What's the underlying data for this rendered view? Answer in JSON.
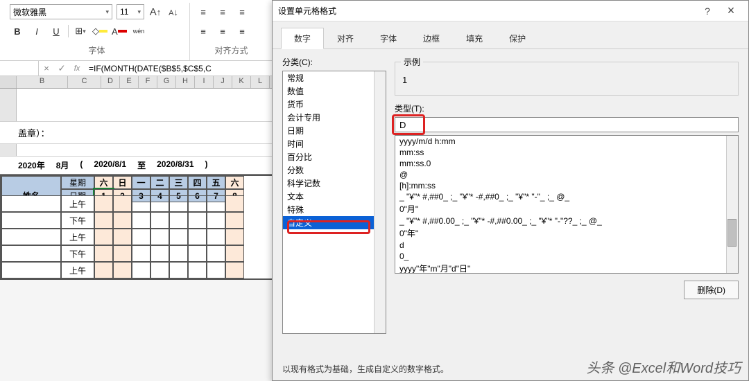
{
  "ribbon": {
    "font_name": "微软雅黑",
    "font_size": "11",
    "grow": "A",
    "shrink": "A",
    "bold": "B",
    "italic": "I",
    "underline": "U",
    "wen": "wén",
    "group_font": "字体",
    "group_align": "对齐方式"
  },
  "formula": {
    "cancel": "×",
    "confirm": "✓",
    "fx": "fx",
    "text": "=IF(MONTH(DATE($B$5,$C$5,C"
  },
  "cols": [
    "B",
    "C",
    "D",
    "E",
    "F",
    "G",
    "H",
    "I",
    "J",
    "K",
    "L"
  ],
  "info_suffix": "盖章）：",
  "date_row": {
    "year": "2020年",
    "month": "8月",
    "lp": "(",
    "start": "2020/8/1",
    "to": "至",
    "end": "2020/8/31",
    "rp": ")"
  },
  "grid": {
    "name_label": "姓名",
    "week_label": "星期",
    "date_label": "日期",
    "weekdays": [
      "六",
      "日",
      "一",
      "二",
      "三",
      "四",
      "五",
      "六"
    ],
    "dates": [
      "1",
      "2",
      "3",
      "4",
      "5",
      "6",
      "7",
      "8"
    ],
    "am": "上午",
    "pm": "下午"
  },
  "dialog": {
    "title": "设置单元格格式",
    "help": "?",
    "close": "×",
    "tabs": [
      "数字",
      "对齐",
      "字体",
      "边框",
      "填充",
      "保护"
    ],
    "category_label": "分类(C):",
    "categories": [
      "常规",
      "数值",
      "货币",
      "会计专用",
      "日期",
      "时间",
      "百分比",
      "分数",
      "科学记数",
      "文本",
      "特殊",
      "自定义"
    ],
    "selected_category": "自定义",
    "example_label": "示例",
    "example_value": "1",
    "type_label": "类型(T):",
    "type_value": "D",
    "formats": [
      "yyyy/m/d h:mm",
      "mm:ss",
      "mm:ss.0",
      "@",
      "[h]:mm:ss",
      "_ \"¥\"* #,##0_ ;_ \"¥\"* -#,##0_ ;_ \"¥\"* \"-\"_ ;_ @_ ",
      "0\"月\"",
      "_ \"¥\"* #,##0.00_ ;_ \"¥\"* -#,##0.00_ ;_ \"¥\"* \"-\"??_ ;_ @_ ",
      "0\"年\"",
      "d",
      "0_ ",
      "yyyy\"年\"m\"月\"d\"日\""
    ],
    "delete": "删除(D)",
    "footer": "以现有格式为基础，生成自定义的数字格式。"
  },
  "watermark": "头条 @Excel和Word技巧"
}
